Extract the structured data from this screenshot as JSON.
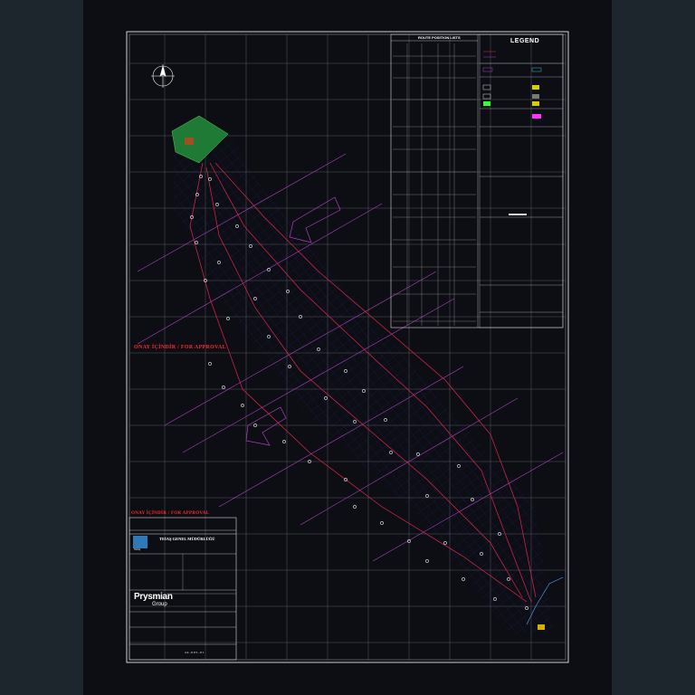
{
  "drawing": {
    "approval_stamp_main": "ONAY İÇİNDİR / FOR APPROVAL",
    "approval_stamp_titleblock": "ONAY İÇİNDİR / FOR APPROVAL",
    "route_table_title": "ROUTE POSITION LISTS",
    "legend_title": "LEGEND",
    "owner_name": "TEİAŞ GENEL MÜDÜRLÜĞÜ",
    "owner_logo": "TEİAŞ",
    "contractor_logo_main": "Prysmian",
    "contractor_logo_sub": "Group",
    "sheet_number": "4 4 - 0 0 5 - 0 1",
    "north_arrow_icon": "north-arrow-icon",
    "colors": {
      "route_red": "#e0284a",
      "grid_blue": "#3a3acc",
      "offset_magenta": "#c040c0",
      "sheet_white": "#e8e8e8",
      "land_green": "#2a8a3a",
      "highlight_green": "#33ff33"
    }
  }
}
